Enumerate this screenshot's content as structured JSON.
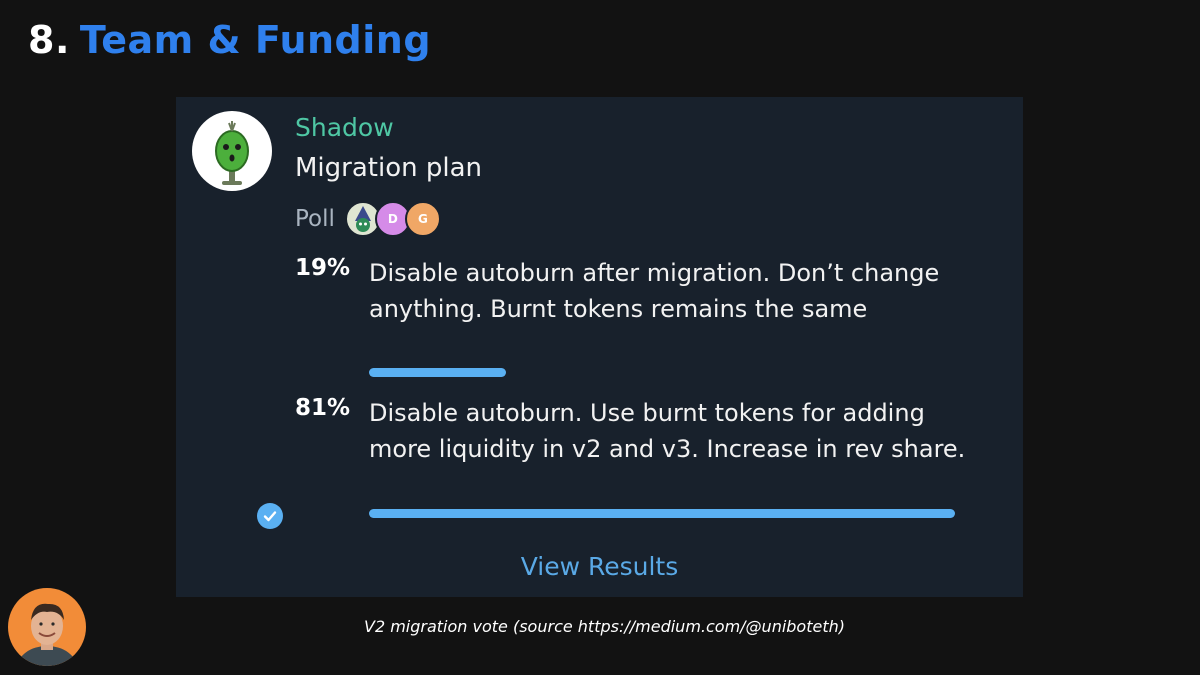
{
  "slide": {
    "number": "8.",
    "title": "Team & Funding",
    "caption": "V2 migration vote (source https://medium.com/@uniboteth)"
  },
  "colors": {
    "title_accent": "#2f80ed",
    "sender": "#4fc7a4",
    "bar": "#5ab0f2",
    "card_bg": "#18212c",
    "presenter_bg": "#f28c38"
  },
  "poll": {
    "sender": "Shadow",
    "question": "Migration plan",
    "type_label": "Poll",
    "voters": [
      {
        "initial": "",
        "icon": "wizard-avatar-icon"
      },
      {
        "initial": "D",
        "icon": "letter-avatar"
      },
      {
        "initial": "G",
        "icon": "letter-avatar"
      }
    ],
    "options": [
      {
        "percent_label": "19%",
        "percent": 19,
        "text": "Disable autoburn after migration. Don’t change anything. Burnt tokens remains the same",
        "selected": false
      },
      {
        "percent_label": "81%",
        "percent": 81,
        "text": "Disable autoburn. Use burnt tokens for adding more liquidity in v2 and v3. Increase in rev share.",
        "selected": true
      }
    ],
    "view_results_label": "View Results"
  }
}
